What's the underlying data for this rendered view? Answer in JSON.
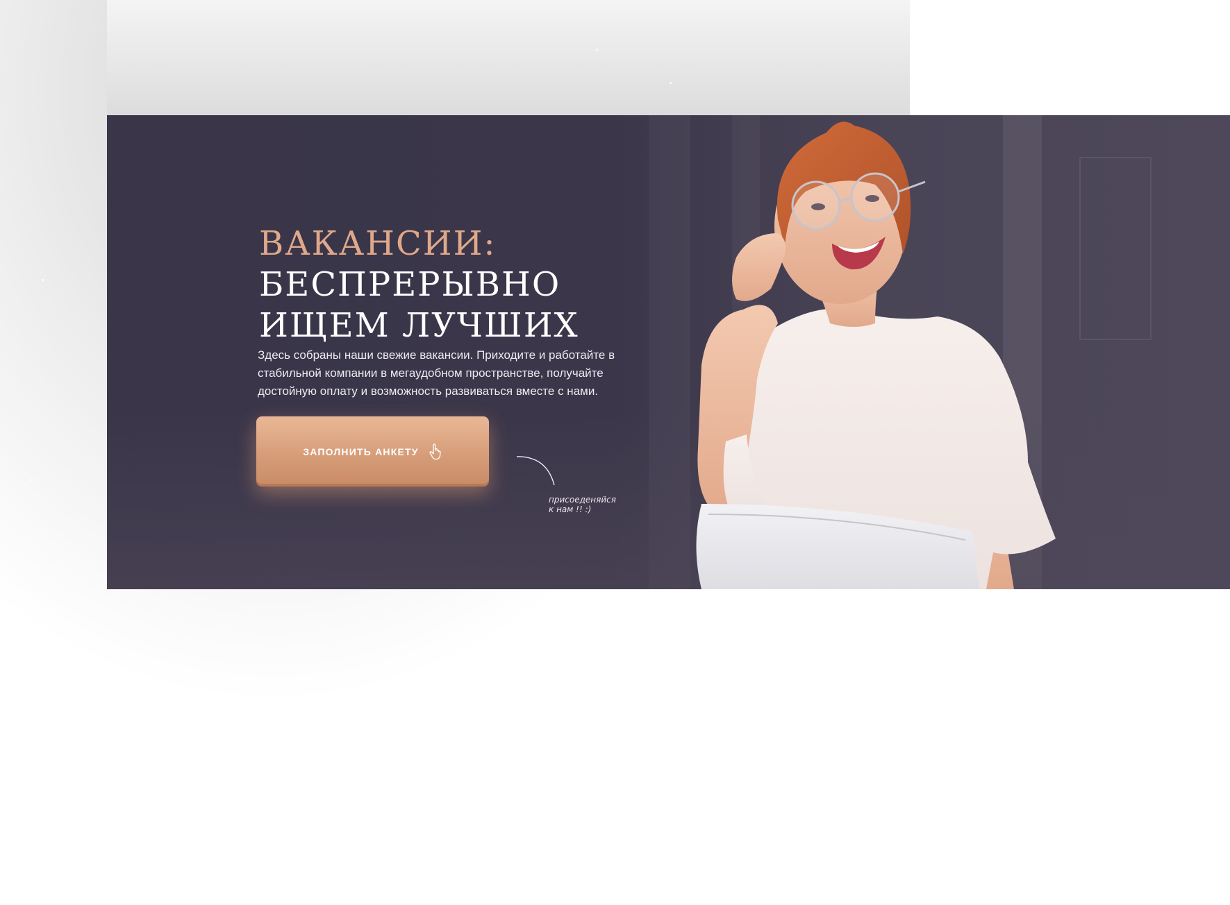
{
  "hero": {
    "title_accent": "ВАКАНСИИ:",
    "title_line_1": "БЕСПРЕРЫВНО",
    "title_line_2": "ИЩЕМ ЛУЧШИХ",
    "lead": "Здесь собраны наши свежие вакансии. Приходите и работайте в стабильной компании в мегаудобном пространстве, получайте достойную оплату и возможность развиваться вместе с нами.",
    "cta_label": "ЗАПОЛНИТЬ АНКЕТУ",
    "note_line_1": "присоеденяйся",
    "note_line_2": "к нам !! :)"
  },
  "icons": {
    "cta": "hand-pointer-icon"
  },
  "colors": {
    "panel": "#3b3649",
    "accent": "#e0a88a",
    "button": "#d69d79"
  }
}
